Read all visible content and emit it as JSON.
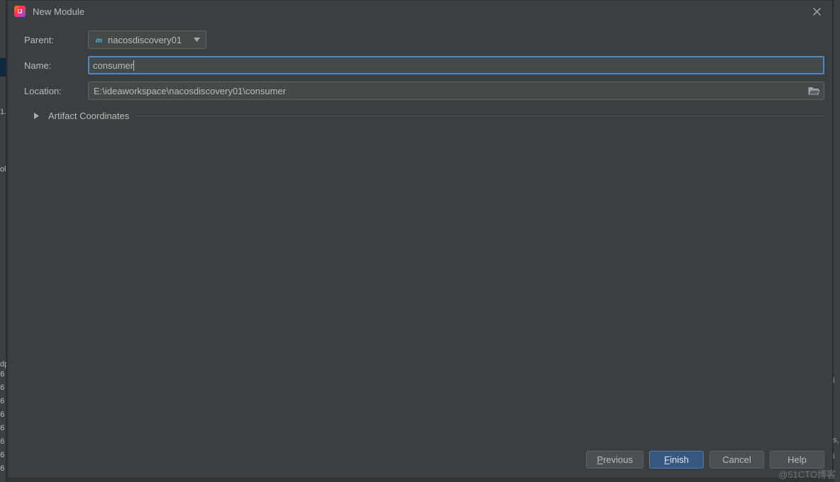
{
  "window": {
    "title": "New Module",
    "app_icon": "intellij-idea-logo-icon",
    "close_icon": "close-icon",
    "background_color": "#3C3F41",
    "accent_color": "#365880",
    "focus_border_color": "#4A88C7"
  },
  "form": {
    "parent": {
      "label": "Parent:",
      "icon": "maven-module-icon",
      "icon_glyph": "m",
      "icon_color": "#40B6D4",
      "value": "nacosdiscovery01",
      "arrow_icon": "chevron-down-icon"
    },
    "name": {
      "label": "Name:",
      "value": "consumer",
      "focused": true
    },
    "location": {
      "label": "Location:",
      "value": "E:\\ideaworkspace\\nacosdiscovery01\\consumer",
      "browse_icon": "folder-icon"
    }
  },
  "artifact_coordinates": {
    "label": "Artifact Coordinates",
    "expanded": false,
    "triangle_icon": "triangle-right-icon"
  },
  "buttons": {
    "previous": {
      "label": "Previous",
      "mnemonic": "P",
      "rest": "revious",
      "default": false
    },
    "finish": {
      "label": "Finish",
      "mnemonic": "F",
      "rest": "inish",
      "default": true
    },
    "cancel": {
      "label": "Cancel",
      "mnemonic": "",
      "rest": "Cancel",
      "default": false
    },
    "help": {
      "label": "Help",
      "mnemonic": "",
      "rest": "Help",
      "default": false
    }
  },
  "watermark": {
    "text": "@51CTO博客"
  },
  "ide_background": {
    "left_fragments": [
      "1.",
      "ol",
      "dp"
    ],
    "right_fragments": [
      "i",
      "s,",
      "i"
    ],
    "console_fragments": [
      "6",
      "6",
      "6",
      "6",
      "6",
      "6",
      "6"
    ]
  }
}
